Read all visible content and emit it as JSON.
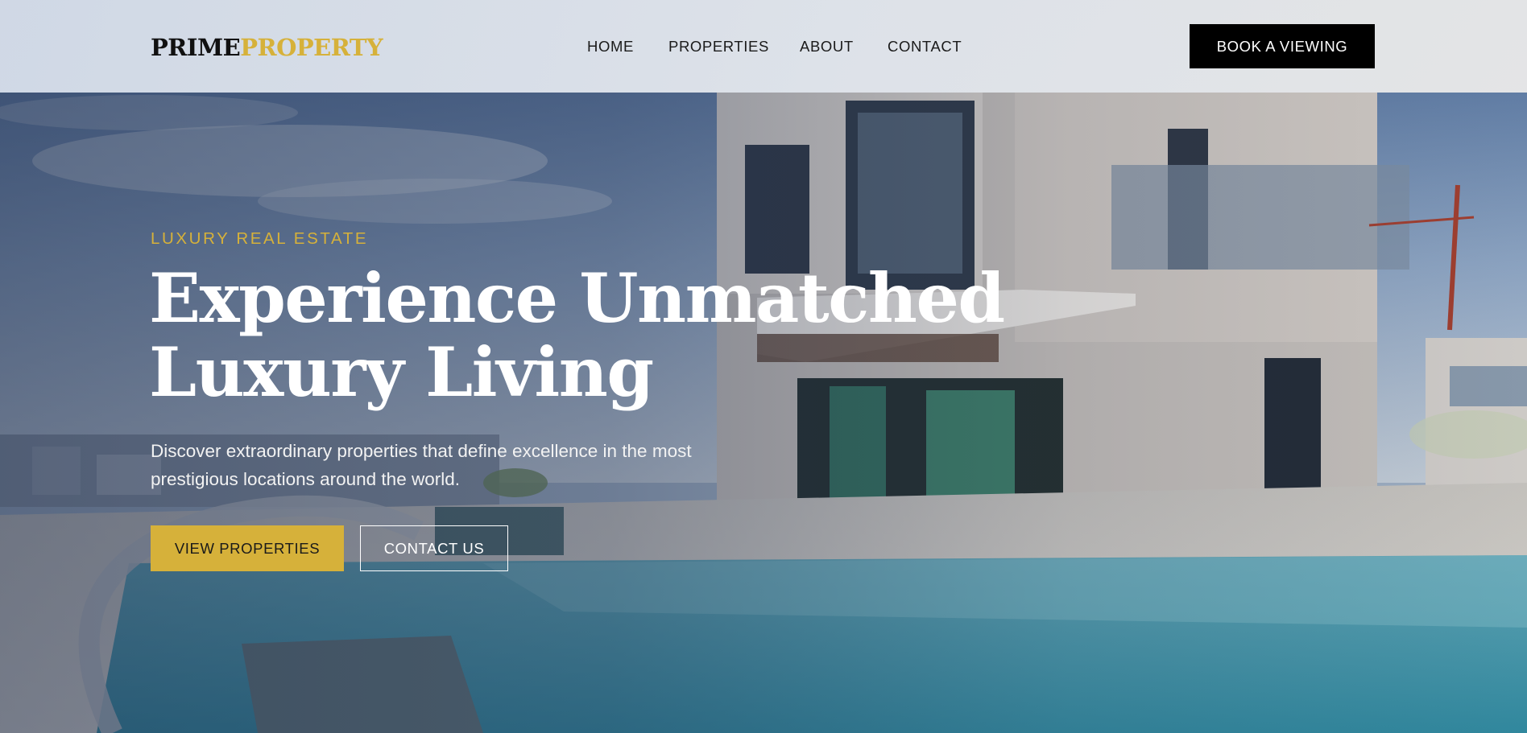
{
  "brand": {
    "part1": "PRIME",
    "part2": "PROPERTY"
  },
  "nav": [
    {
      "label": "HOME"
    },
    {
      "label": "PROPERTIES"
    },
    {
      "label": "ABOUT"
    },
    {
      "label": "CONTACT"
    }
  ],
  "header_cta": "BOOK A VIEWING",
  "hero": {
    "eyebrow": "LUXURY REAL ESTATE",
    "title_line1": "Experience Unmatched",
    "title_line2": "Luxury Living",
    "subtitle_line1": "Discover extraordinary properties that define excellence in the most",
    "subtitle_line2": "prestigious locations around the world.",
    "primary_button": "VIEW PROPERTIES",
    "secondary_button": "CONTACT US"
  },
  "colors": {
    "accent_gold": "#d6b13a",
    "header_button_bg": "#000000",
    "text_dark": "#1a1a1a"
  }
}
